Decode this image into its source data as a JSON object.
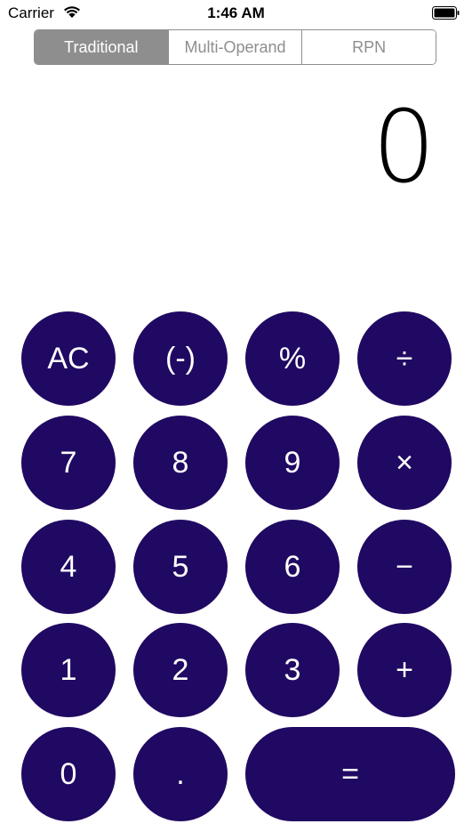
{
  "status_bar": {
    "carrier": "Carrier",
    "time": "1:46 AM",
    "wifi_icon": "wifi-icon",
    "battery_icon": "battery-icon"
  },
  "segmented_control": {
    "segments": [
      "Traditional",
      "Multi-Operand",
      "RPN"
    ],
    "selected": "Traditional",
    "selected_color": "#8e8e8e"
  },
  "display": {
    "value": "0"
  },
  "keypad": {
    "button_color": "#200962",
    "text_color": "#ffffff",
    "rows": [
      [
        "AC",
        "(-)",
        "%",
        "÷"
      ],
      [
        "7",
        "8",
        "9",
        "×"
      ],
      [
        "4",
        "5",
        "6",
        "−"
      ],
      [
        "1",
        "2",
        "3",
        "+"
      ],
      [
        "0",
        ".",
        "="
      ]
    ]
  }
}
